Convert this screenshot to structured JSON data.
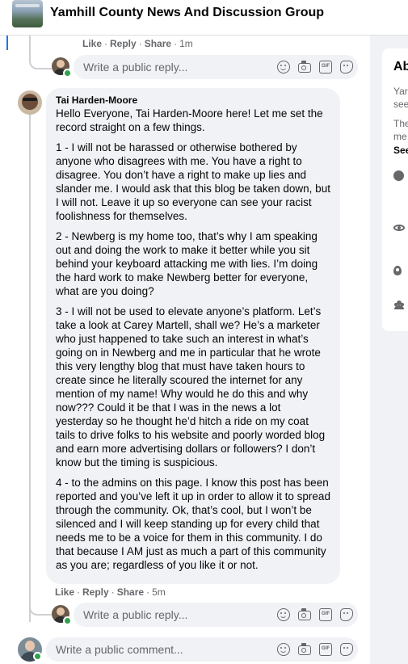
{
  "header": {
    "group_name": "Yamhill County News And Discussion Group"
  },
  "prev_comment_actions": {
    "like": "Like",
    "reply": "Reply",
    "share": "Share",
    "time": "1m"
  },
  "reply_placeholder": "Write a public reply...",
  "comment": {
    "author": "Tai Harden-Moore",
    "paragraphs": [
      "Hello Everyone, Tai Harden-Moore here! Let me set the record straight on a few things.",
      "1 - I will not be harassed or otherwise bothered by anyone who disagrees with me. You have a right to disagree. You don’t have a right to make up lies and slander me. I would ask that this blog be taken down, but I will not. Leave it up so everyone can see your racist foolishness for themselves.",
      "2 - Newberg is my home too, that’s why I am speaking out and doing the work to make it better while you sit behind your keyboard attacking me with lies. I’m doing the hard work to make Newberg better for everyone, what are you doing?",
      "3 - I will not be used to elevate anyone’s platform. Let’s take a look at Carey Martell, shall we? He’s a marketer who just happened to take such an interest in what’s going on in Newberg and me in particular that he wrote this very lengthy blog that must have taken hours to create since he literally scoured the internet for any mention of my name! Why would he do this and why now??? Could it be that I was in the news a lot yesterday so he thought he’d hitch a ride on my coat tails to drive folks to his website and poorly worded blog and earn more advertising dollars or followers? I don’t know but the timing is suspicious.",
      "4 - to the admins on this page. I know this post has been reported and you’ve left it up in order to allow it to spread through the community. Ok, that’s cool, but I won’t be silenced and I will keep standing up for every child that needs me to be a voice for them in this community. I do that because I AM just as much a part of this community as you are; regardless of you like it or not."
    ],
    "actions": {
      "like": "Like",
      "reply": "Reply",
      "share": "Share",
      "time": "5m"
    }
  },
  "comment_placeholder": "Write a public comment...",
  "composer_icons": [
    "emoji-icon",
    "camera-icon",
    "gif-icon",
    "sticker-icon"
  ],
  "gif_text": "GIF",
  "sidebar": {
    "title": "Ab",
    "line1": "Yar",
    "line2": "see",
    "line3": "The",
    "line4": "me",
    "see_more": "See",
    "icons": [
      "globe-icon",
      "eye-icon",
      "location-pin-icon",
      "members-icon"
    ]
  },
  "colors": {
    "accent": "#1877f2",
    "online": "#31a24c",
    "bubble": "#f0f2f5",
    "secondary_text": "#65676b"
  }
}
